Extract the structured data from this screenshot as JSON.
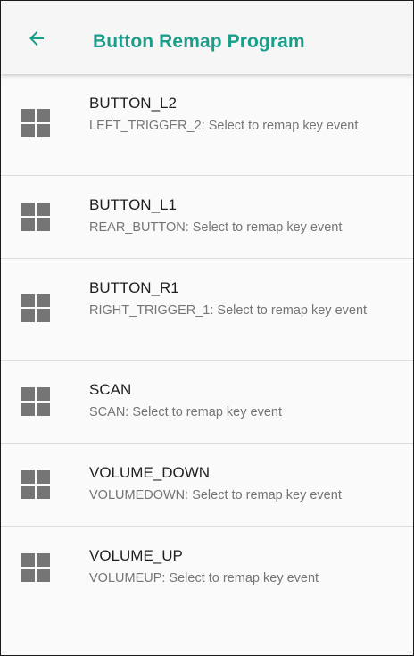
{
  "app_bar": {
    "title": "Button Remap Program",
    "back_icon": "arrow-back-icon",
    "accent_color": "#1a9e8a"
  },
  "items": [
    {
      "title": "BUTTON_L2",
      "summary": "LEFT_TRIGGER_2: Select to remap key event",
      "icon": "grid-icon"
    },
    {
      "title": "BUTTON_L1",
      "summary": "REAR_BUTTON: Select to remap key event",
      "icon": "grid-icon"
    },
    {
      "title": "BUTTON_R1",
      "summary": "RIGHT_TRIGGER_1: Select to remap key event",
      "icon": "grid-icon"
    },
    {
      "title": "SCAN",
      "summary": "SCAN: Select to remap key event",
      "icon": "grid-icon"
    },
    {
      "title": "VOLUME_DOWN",
      "summary": "VOLUMEDOWN: Select to remap key event",
      "icon": "grid-icon"
    },
    {
      "title": "VOLUME_UP",
      "summary": "VOLUMEUP: Select to remap key event",
      "icon": "grid-icon"
    }
  ]
}
